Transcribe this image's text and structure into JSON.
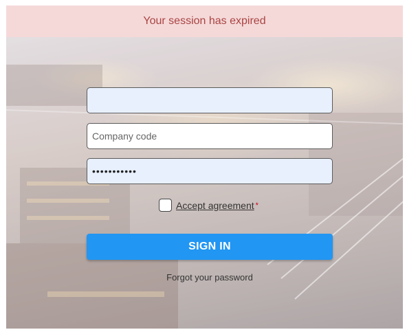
{
  "banner": {
    "message": "Your session has expired"
  },
  "form": {
    "username": {
      "value": "",
      "placeholder": ""
    },
    "company_code": {
      "value": "",
      "placeholder": "Company code"
    },
    "password": {
      "value": "•••••••••••",
      "placeholder": ""
    },
    "agreement": {
      "label": "Accept agreement",
      "required_mark": "*",
      "checked": false
    },
    "sign_in_label": "SIGN IN",
    "forgot_label": "Forgot your password"
  },
  "colors": {
    "banner_bg": "#f5d9d9",
    "banner_text": "#a94442",
    "primary": "#2196f3",
    "autofill_bg": "#e8f0fe",
    "required": "#d0021b"
  }
}
